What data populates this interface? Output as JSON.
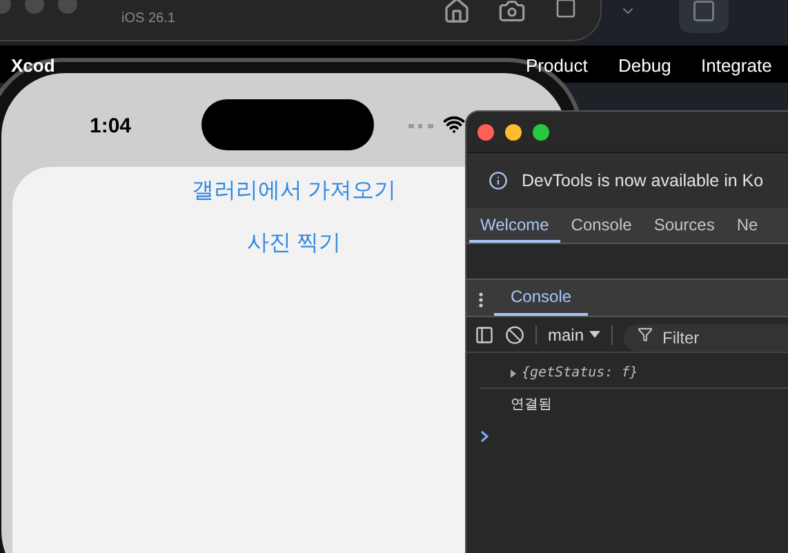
{
  "simulator_toolbar": {
    "subtitle": "iOS 26.1"
  },
  "menu_bar": {
    "items": [
      {
        "label": "Xcod",
        "bold": true
      },
      {
        "label": "Product",
        "bold": false
      },
      {
        "label": "Debug",
        "bold": false
      },
      {
        "label": "Integrate",
        "bold": false
      }
    ]
  },
  "phone": {
    "time": "1:04",
    "sheet_actions": [
      "갤러리에서 가져오기",
      "사진 찍기"
    ]
  },
  "devtools": {
    "banner": "DevTools is now available in Ko",
    "tabs": [
      {
        "label": "Welcome",
        "selected": true
      },
      {
        "label": "Console",
        "selected": false
      },
      {
        "label": "Sources",
        "selected": false
      },
      {
        "label": "Ne",
        "selected": false
      }
    ],
    "drawer_tabs": [
      {
        "label": "Console",
        "selected": true
      }
    ],
    "context": "main",
    "filter_placeholder": "Filter",
    "messages": [
      {
        "kind": "object",
        "text": "{getStatus: f}"
      },
      {
        "kind": "log",
        "text": "연결됨"
      }
    ]
  }
}
